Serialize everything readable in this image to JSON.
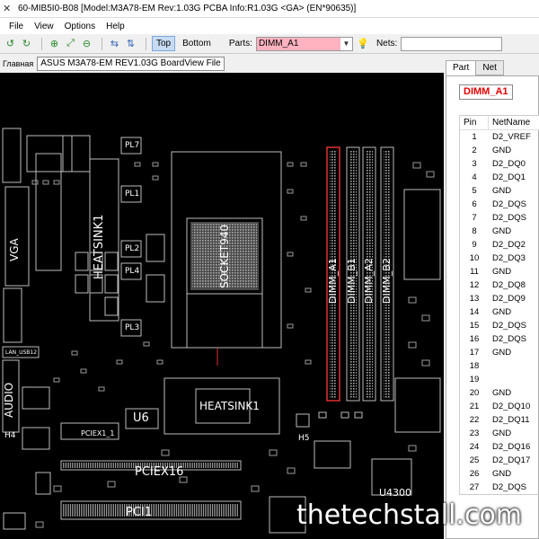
{
  "window": {
    "title": "60-MIB5I0-B08 [Model:M3A78-EM Rev:1.03G PCBA Info:R1.03G <GA> (EN*90635)]"
  },
  "menu": [
    "File",
    "View",
    "Options",
    "Help"
  ],
  "toolbar": {
    "top_label": "Top",
    "bottom_label": "Bottom",
    "parts_label": "Parts:",
    "parts_value": "DIMM_A1",
    "nets_label": "Nets:",
    "nets_value": ""
  },
  "tabs": {
    "home_label": "Главная",
    "file_tab": "ASUS M3A78-EM REV1.03G BoardView File"
  },
  "board_labels": {
    "socket": "SOCKET940",
    "dimm_a1": "DIMM_A1",
    "dimm_b1": "DIMM_B1",
    "dimm_a2": "DIMM_A2",
    "dimm_b2": "DIMM_B2",
    "vga": "VGA",
    "heatsink1": "HEATSINK1",
    "heatsink2": "HEATSINK1",
    "audio": "AUDIO",
    "pciex16": "PCIEX16",
    "pciex1": "PCIEX1_1",
    "pci1": "PCI1",
    "u6": "U6",
    "u4300": "U4300",
    "h4": "H4",
    "h5": "H5",
    "pl7": "PL7",
    "pl1": "PL1",
    "pl2": "PL2",
    "pl4": "PL4",
    "pl3": "PL3",
    "lan": "LAN_USB12"
  },
  "panel": {
    "tab_part": "Part",
    "tab_net": "Net",
    "selected_part": "DIMM_A1",
    "col_pin": "Pin",
    "col_net": "NetName",
    "rows": [
      [
        "1",
        "D2_VREF"
      ],
      [
        "2",
        "GND"
      ],
      [
        "3",
        "D2_DQ0"
      ],
      [
        "4",
        "D2_DQ1"
      ],
      [
        "5",
        "GND"
      ],
      [
        "6",
        "D2_DQS"
      ],
      [
        "7",
        "D2_DQS"
      ],
      [
        "8",
        "GND"
      ],
      [
        "9",
        "D2_DQ2"
      ],
      [
        "10",
        "D2_DQ3"
      ],
      [
        "11",
        "GND"
      ],
      [
        "12",
        "D2_DQ8"
      ],
      [
        "13",
        "D2_DQ9"
      ],
      [
        "14",
        "GND"
      ],
      [
        "15",
        "D2_DQS"
      ],
      [
        "16",
        "D2_DQS"
      ],
      [
        "17",
        "GND"
      ],
      [
        "18",
        ""
      ],
      [
        "19",
        ""
      ],
      [
        "20",
        "GND"
      ],
      [
        "21",
        "D2_DQ10"
      ],
      [
        "22",
        "D2_DQ11"
      ],
      [
        "23",
        "GND"
      ],
      [
        "24",
        "D2_DQ16"
      ],
      [
        "25",
        "D2_DQ17"
      ],
      [
        "26",
        "GND"
      ],
      [
        "27",
        "D2_DQS"
      ]
    ]
  },
  "watermark": "thetechstall.com",
  "colors": {
    "highlight": "#ffb3c1",
    "selected_dimm": "#e03030",
    "board_bg": "#000000"
  }
}
